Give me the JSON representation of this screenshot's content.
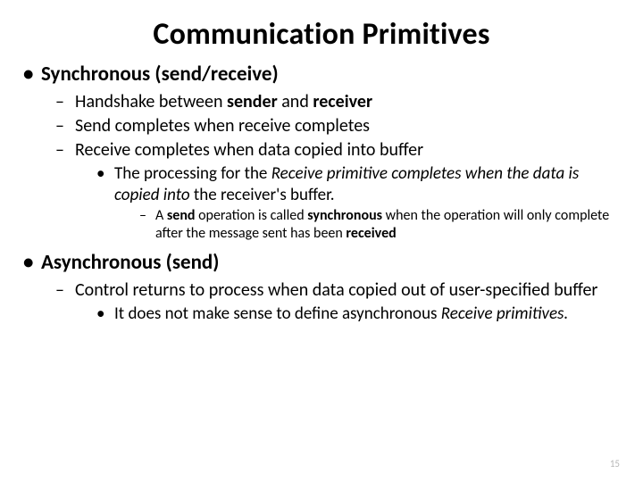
{
  "title": "Communication Primitives",
  "page_number": "15",
  "sync": {
    "heading": "Synchronous (send/receive)",
    "p1_a": "Handshake between ",
    "p1_b": "sender",
    "p1_c": " and ",
    "p1_d": "receiver",
    "p2": "Send completes when receive completes",
    "p3": "Receive completes when data copied into buffer",
    "p3a_a": "The processing for the ",
    "p3a_b": "Receive primitive completes when the data is copied into",
    "p3a_c": " the receiver's buffer.",
    "p3b_a": "A ",
    "p3b_b": "send",
    "p3b_c": " operation is called ",
    "p3b_d": "synchronous",
    "p3b_e": " when the operation will only complete after the message sent has been ",
    "p3b_f": "received"
  },
  "async": {
    "heading": "Asynchronous (send)",
    "p1": "Control returns to process when data copied out of user-specified buffer",
    "p1a_a": "It does not make sense to define asynchronous ",
    "p1a_b": "Receive primitives."
  }
}
